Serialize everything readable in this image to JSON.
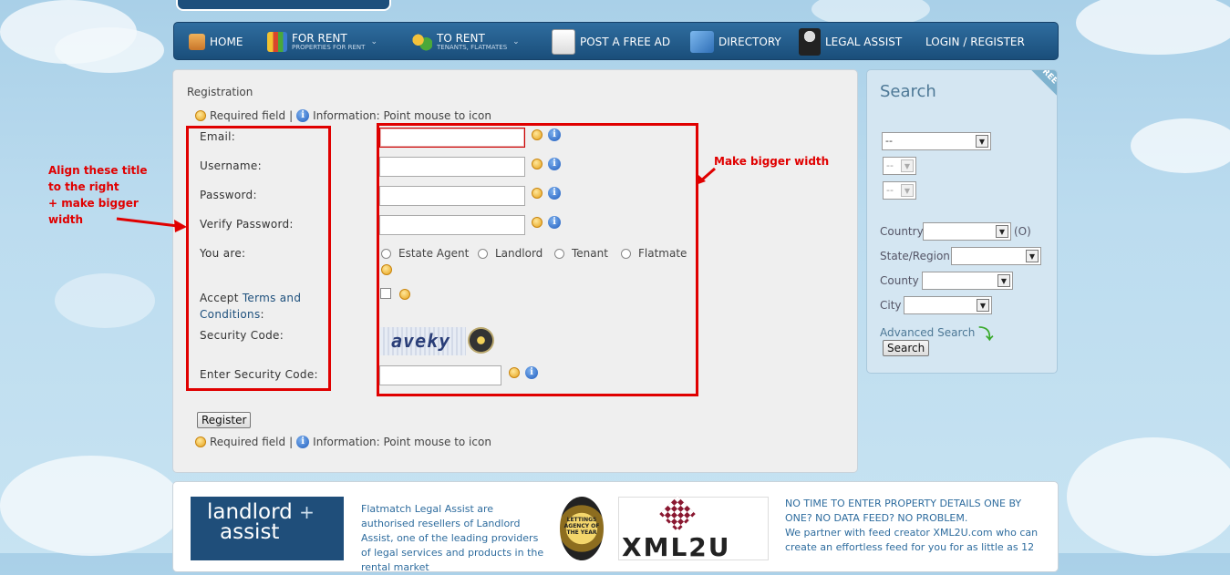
{
  "nav": {
    "items": [
      {
        "label": "HOME"
      },
      {
        "label": "FOR RENT",
        "sub": "PROPERTIES FOR RENT"
      },
      {
        "label": "TO RENT",
        "sub": "TENANTS, FLATMATES"
      },
      {
        "label": "POST A FREE AD"
      },
      {
        "label": "DIRECTORY"
      },
      {
        "label": "LEGAL ASSIST"
      },
      {
        "label": "LOGIN / REGISTER"
      }
    ]
  },
  "form": {
    "title": "Registration",
    "required_text": "Required field",
    "separator": "|",
    "info_text": "Information: Point mouse to icon",
    "labels": {
      "email": "Email:",
      "username": "Username:",
      "password": "Password:",
      "verify": "Verify Password:",
      "you_are": "You are:",
      "accept": "Accept",
      "terms": "Terms and Conditions",
      "colon": ":",
      "security": "Security Code:",
      "enter_security": "Enter Security Code:"
    },
    "roles": [
      "Estate Agent",
      "Landlord",
      "Tenant",
      "Flatmate"
    ],
    "captcha_text": "aveky",
    "register_button": "Register"
  },
  "annotations": {
    "left_note": [
      "Align these title",
      "to the right",
      "+ make bigger",
      "width"
    ],
    "right_note": "Make bigger width",
    "colors": {
      "annotation": "#e00000"
    }
  },
  "search": {
    "title": "Search",
    "ribbon": "FREE",
    "select1": "--",
    "select2": "--",
    "select3": "--",
    "country_label": "Country",
    "country_suffix": "(O)",
    "state_label": "State/Region",
    "county_label": "County",
    "city_label": "City",
    "advanced": "Advanced Search",
    "button": "Search"
  },
  "bottom": {
    "landlord_line1": "landlord",
    "landlord_plus": "+",
    "landlord_line2": "assist",
    "text1": "Flatmatch Legal Assist are authorised resellers of Landlord Assist, one of the leading providers of legal services and products in the rental market",
    "award_text": "LETTINGS AGENCY OF THE YEAR",
    "xml_text": "XML2U",
    "text2_line1": "NO TIME TO ENTER PROPERTY DETAILS ONE BY ONE?  NO DATA FEED?  NO PROBLEM.",
    "text2_line2": "We partner with feed creator XML2U.com who can create an effortless feed for you for as little as 12"
  }
}
